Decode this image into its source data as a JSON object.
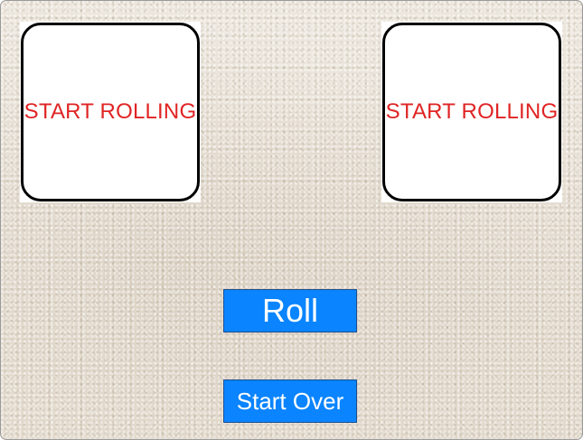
{
  "dice": [
    {
      "label": "START ROLLING"
    },
    {
      "label": "START ROLLING"
    }
  ],
  "buttons": {
    "roll_label": "Roll",
    "start_over_label": "Start Over"
  },
  "colors": {
    "die_text": "#e02424",
    "button_bg": "#0a84ff",
    "button_text": "#ffffff"
  }
}
